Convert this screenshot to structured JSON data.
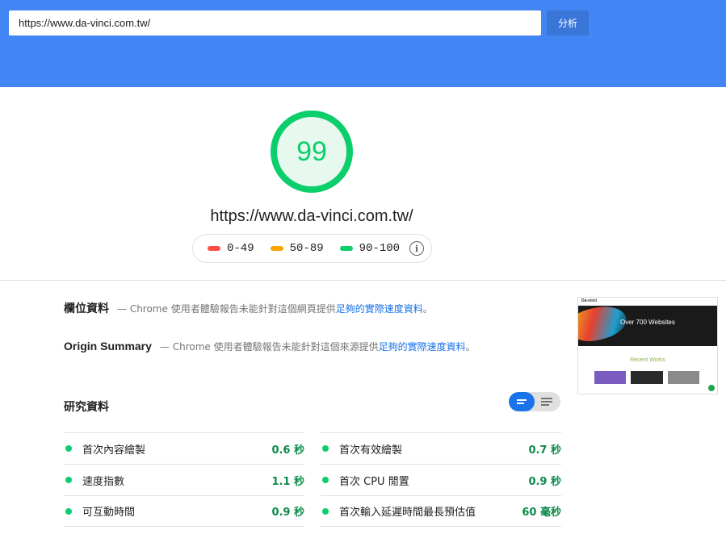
{
  "search": {
    "url_value": "https://www.da-vinci.com.tw/",
    "analyze_label": "分析"
  },
  "summary": {
    "score": "99",
    "url": "https://www.da-vinci.com.tw/",
    "legend": [
      {
        "label": "0-49",
        "color": "#ff4e42"
      },
      {
        "label": "50-89",
        "color": "#ffa400"
      },
      {
        "label": "90-100",
        "color": "#0cce6b"
      }
    ],
    "info_icon": "i"
  },
  "field_data": {
    "title": "欄位資料",
    "desc_prefix": "— Chrome 使用者體驗報告未能針對這個網頁提供",
    "link": "足夠的實際速度資料",
    "desc_suffix": "。"
  },
  "origin_summary": {
    "title": "Origin Summary",
    "desc_prefix": "— Chrome 使用者體驗報告未能針對這個來源提供",
    "link": "足夠的實際速度資料",
    "desc_suffix": "。"
  },
  "screenshot": {
    "logo": "Da-vinci",
    "hero_title": "Over 700 Websites",
    "recent_title": "Recent Works"
  },
  "lab_data": {
    "title": "研究資料",
    "metrics_left": [
      {
        "label": "首次內容繪製",
        "value": "0.6 秒"
      },
      {
        "label": "速度指數",
        "value": "1.1 秒"
      },
      {
        "label": "可互動時間",
        "value": "0.9 秒"
      }
    ],
    "metrics_right": [
      {
        "label": "首次有效繪製",
        "value": "0.7 秒"
      },
      {
        "label": "首次 CPU 閒置",
        "value": "0.9 秒"
      },
      {
        "label": "首次輸入延遲時間最長預估值",
        "value": "60 毫秒"
      }
    ]
  },
  "colors": {
    "header_bg": "#4285f4",
    "pass": "#0cce6b",
    "pass_text": "#0a8b48",
    "link": "#1a73e8"
  }
}
